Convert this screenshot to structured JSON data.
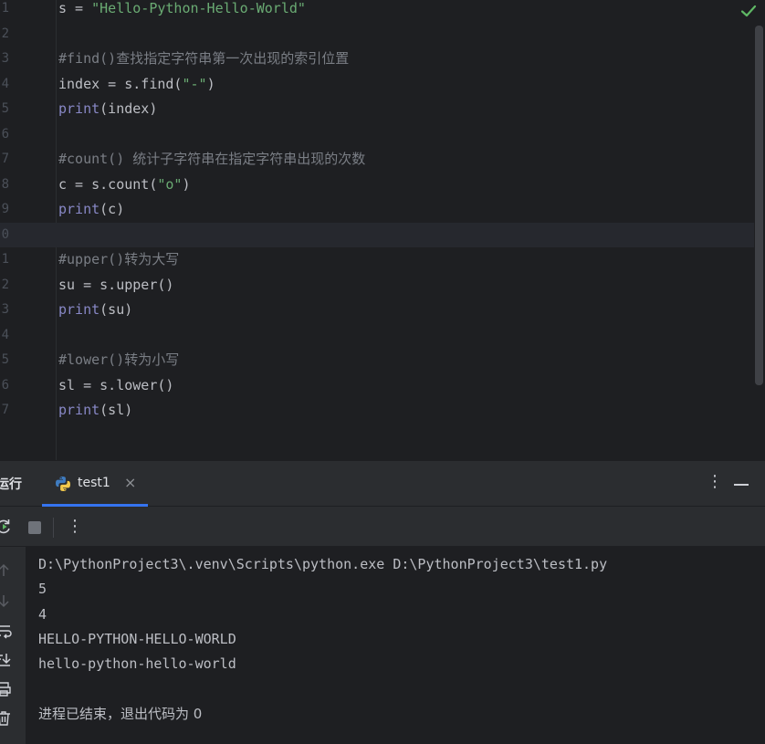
{
  "editor": {
    "lines": [
      {
        "n": "1",
        "tokens": [
          {
            "t": "s = ",
            "c": "def"
          },
          {
            "t": "\"Hello-Python-Hello-World\"",
            "c": "str"
          }
        ]
      },
      {
        "n": "2",
        "tokens": []
      },
      {
        "n": "3",
        "tokens": [
          {
            "t": "#find()查找指定字符串第一次出现的索引位置",
            "c": "com"
          }
        ]
      },
      {
        "n": "4",
        "tokens": [
          {
            "t": "index = s.find(",
            "c": "def"
          },
          {
            "t": "\"-\"",
            "c": "str"
          },
          {
            "t": ")",
            "c": "def"
          }
        ]
      },
      {
        "n": "5",
        "tokens": [
          {
            "t": "print",
            "c": "fn"
          },
          {
            "t": "(index)",
            "c": "def"
          }
        ]
      },
      {
        "n": "6",
        "tokens": []
      },
      {
        "n": "7",
        "tokens": [
          {
            "t": "#count() 统计子字符串在指定字符串出现的次数",
            "c": "com"
          }
        ]
      },
      {
        "n": "8",
        "tokens": [
          {
            "t": "c = s.count(",
            "c": "def"
          },
          {
            "t": "\"o\"",
            "c": "str"
          },
          {
            "t": ")",
            "c": "def"
          }
        ]
      },
      {
        "n": "9",
        "tokens": [
          {
            "t": "print",
            "c": "fn"
          },
          {
            "t": "(c)",
            "c": "def"
          }
        ]
      },
      {
        "n": "0",
        "tokens": [],
        "current": true
      },
      {
        "n": "1",
        "tokens": [
          {
            "t": "#upper()转为大写",
            "c": "com"
          }
        ]
      },
      {
        "n": "2",
        "tokens": [
          {
            "t": "su = s.upper()",
            "c": "def"
          }
        ]
      },
      {
        "n": "3",
        "tokens": [
          {
            "t": "print",
            "c": "fn"
          },
          {
            "t": "(su)",
            "c": "def"
          }
        ]
      },
      {
        "n": "4",
        "tokens": []
      },
      {
        "n": "5",
        "tokens": [
          {
            "t": "#lower()转为小写",
            "c": "com"
          }
        ]
      },
      {
        "n": "6",
        "tokens": [
          {
            "t": "sl = s.lower()",
            "c": "def"
          }
        ]
      },
      {
        "n": "7",
        "tokens": [
          {
            "t": "print",
            "c": "fn"
          },
          {
            "t": "(sl)",
            "c": "def"
          }
        ]
      }
    ],
    "status_icon": "check-icon"
  },
  "run_panel": {
    "title": "运行",
    "tab_label": "test1",
    "tab_icon": "python-icon",
    "tab_close": "×",
    "more_glyph": "⋮",
    "toolbar": {
      "rerun_icon": "rerun-icon",
      "stop_icon": "stop-icon",
      "more_glyph": "⋮"
    },
    "side_icons": [
      "arrow-up-icon",
      "arrow-down-icon",
      "soft-wrap-icon",
      "scroll-to-end-icon",
      "print-icon",
      "trash-icon"
    ],
    "console": [
      "D:\\PythonProject3\\.venv\\Scripts\\python.exe D:\\PythonProject3\\test1.py",
      "5",
      "4",
      "HELLO-PYTHON-HELLO-WORLD",
      "hello-python-hello-world",
      "",
      "进程已结束，退出代码为 0"
    ]
  },
  "colors": {
    "background": "#1e1f22",
    "panel": "#2b2d30",
    "string": "#6aab73",
    "comment": "#7a7e85",
    "builtin": "#8888c6",
    "accent": "#3574f0",
    "success": "#5fb865"
  }
}
